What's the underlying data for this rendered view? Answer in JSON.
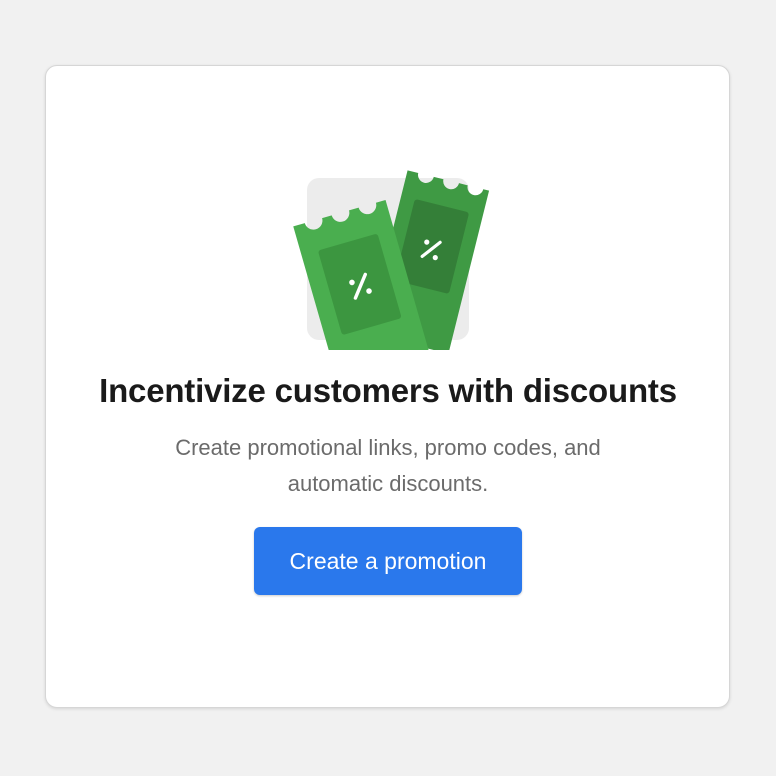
{
  "empty_state": {
    "illustration_icon": "discount-tickets-icon",
    "title": "Incentivize customers with discounts",
    "description": "Create promotional links, promo codes, and automatic discounts.",
    "cta_label": "Create a promotion"
  },
  "colors": {
    "background": "#f1f1f1",
    "card": "#ffffff",
    "accent": "#2a78ec",
    "ticket_green": "#43a047",
    "ticket_green_dark": "#3a8c3e"
  }
}
